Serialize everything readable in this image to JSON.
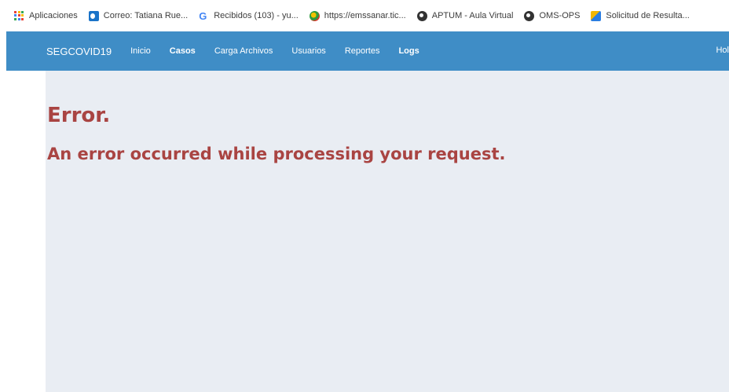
{
  "bookmarks": [
    {
      "label": "Aplicaciones",
      "icon": "apps-grid-icon"
    },
    {
      "label": "Correo: Tatiana Rue...",
      "icon": "outlook-icon"
    },
    {
      "label": "Recibidos (103) - yu...",
      "icon": "google-icon"
    },
    {
      "label": "https://emssanar.tic...",
      "icon": "emssanar-icon"
    },
    {
      "label": "APTUM - Aula Virtual",
      "icon": "globe-icon"
    },
    {
      "label": "OMS-OPS",
      "icon": "globe-icon"
    },
    {
      "label": "Solicitud de Resulta...",
      "icon": "solicitud-icon"
    }
  ],
  "navbar": {
    "brand": "SEGCOVID19",
    "items": [
      {
        "label": "Inicio",
        "bold": false
      },
      {
        "label": "Casos",
        "bold": true
      },
      {
        "label": "Carga Archivos",
        "bold": false
      },
      {
        "label": "Usuarios",
        "bold": false
      },
      {
        "label": "Reportes",
        "bold": false
      },
      {
        "label": "Logs",
        "bold": true
      }
    ],
    "greeting": "Hol"
  },
  "error": {
    "title": "Error.",
    "message": "An error occurred while processing your request."
  },
  "colors": {
    "navbar": "#3f8dc6",
    "error_text": "#a94442",
    "content_bg": "#e9edf3"
  }
}
